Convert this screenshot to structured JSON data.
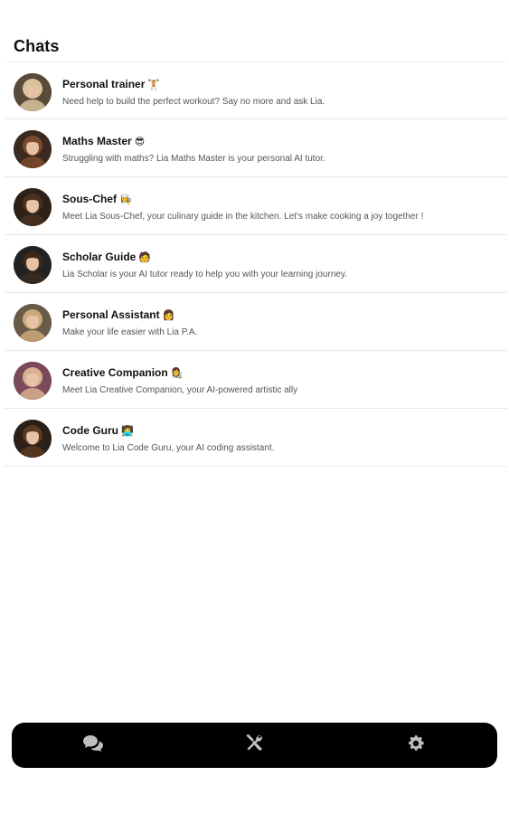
{
  "header": {
    "title": "Chats"
  },
  "chats": [
    {
      "name": "Personal trainer",
      "emoji": "🏋️",
      "description": "Need help to build the perfect workout? Say no more and ask Lia.",
      "avatar_icon": "avatar-blonde-woman",
      "avatar_color": "#5a4a3a",
      "hair_color": "#d8c39a"
    },
    {
      "name": "Maths Master",
      "emoji": "😎",
      "description": "Struggling with maths? Lia Maths Master is your personal AI tutor.",
      "avatar_icon": "avatar-auburn-woman",
      "avatar_color": "#3b2a20",
      "hair_color": "#7a4a2a"
    },
    {
      "name": "Sous-Chef",
      "emoji": "👩‍🍳",
      "description": "Meet Lia Sous-Chef, your culinary guide in the kitchen. Let's make cooking a joy together !",
      "avatar_icon": "avatar-brunette-woman",
      "avatar_color": "#2e2218",
      "hair_color": "#4a3020"
    },
    {
      "name": "Scholar Guide",
      "emoji": "🧑",
      "description": "Lia Scholar is your AI tutor ready to help you with your learning journey.",
      "avatar_icon": "avatar-dark-woman",
      "avatar_color": "#222222",
      "hair_color": "#3a2a1e"
    },
    {
      "name": "Personal Assistant",
      "emoji": "👩",
      "description": "Make your life easier with Lia P.A.",
      "avatar_icon": "avatar-blonde-woman-2",
      "avatar_color": "#6a5a48",
      "hair_color": "#caa878"
    },
    {
      "name": "Creative Companion",
      "emoji": "👩‍🎨",
      "description": "Meet Lia Creative Companion, your AI-powered artistic ally",
      "avatar_icon": "avatar-pink-woman",
      "avatar_color": "#7a4a5a",
      "hair_color": "#d8b090"
    },
    {
      "name": "Code Guru",
      "emoji": "👩‍💻",
      "description": "Welcome to Lia Code Guru, your AI coding assistant.",
      "avatar_icon": "avatar-coder-woman",
      "avatar_color": "#2a2018",
      "hair_color": "#5a3a22"
    }
  ],
  "bottom_nav": {
    "items": [
      {
        "name": "chats",
        "icon": "chat-bubbles-icon"
      },
      {
        "name": "tools",
        "icon": "tools-icon"
      },
      {
        "name": "settings",
        "icon": "gear-icon"
      }
    ],
    "icon_color": "#bfbfbf",
    "bar_color": "#000000"
  }
}
